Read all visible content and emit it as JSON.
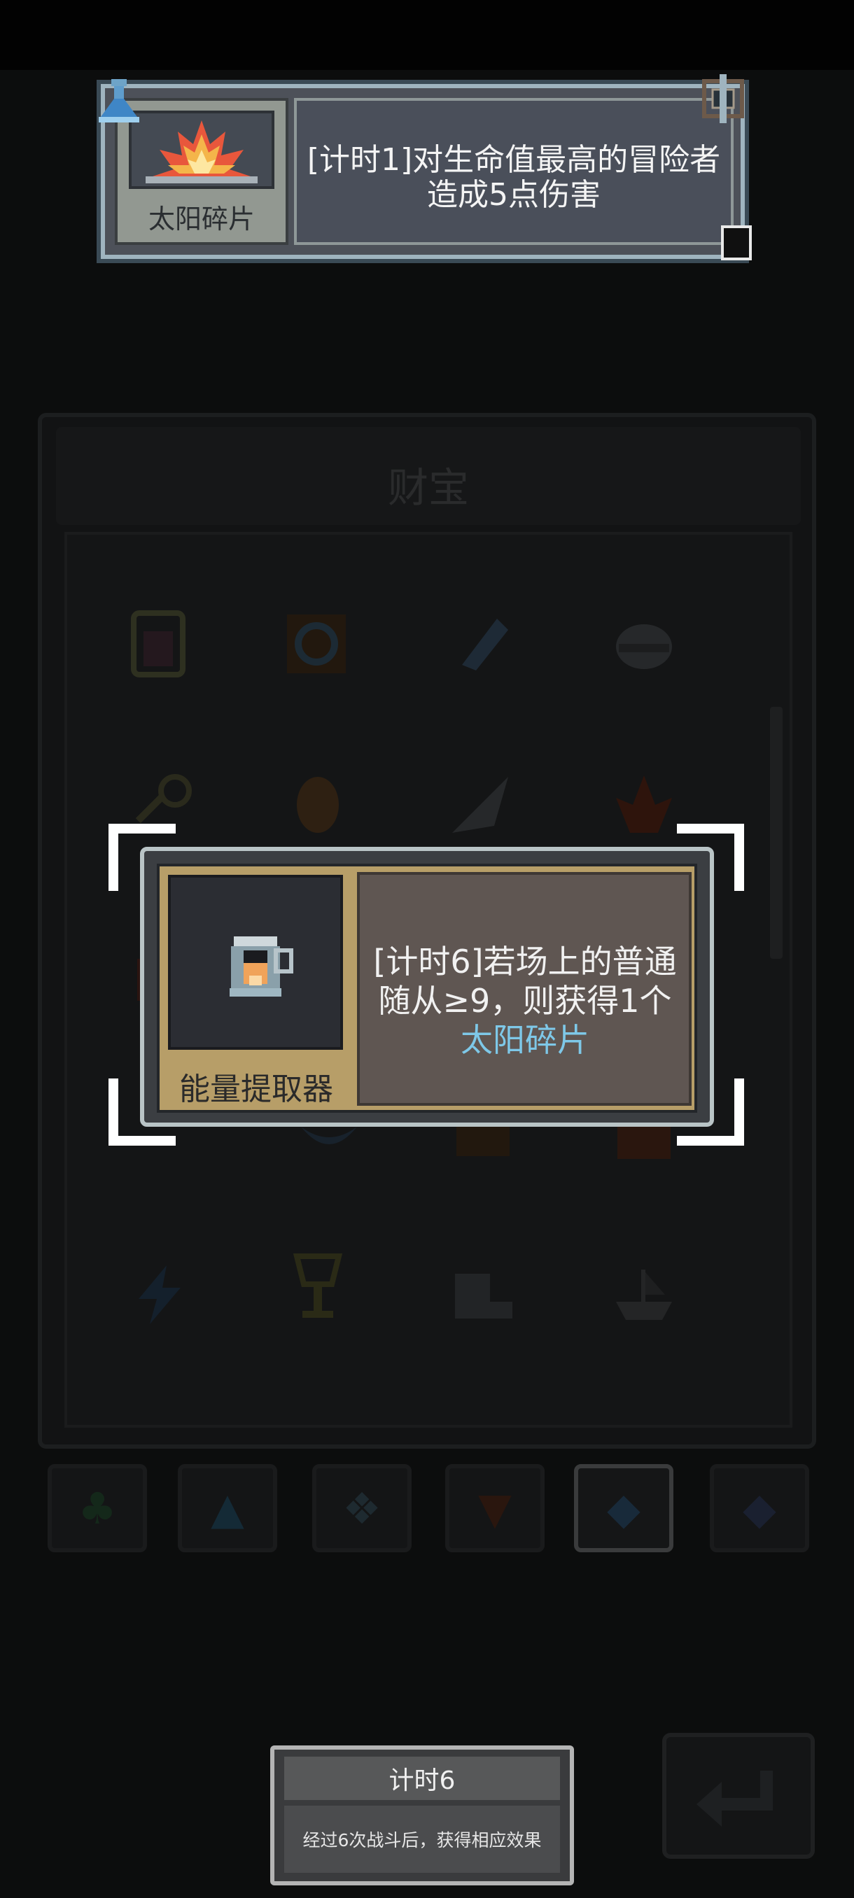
{
  "top_tooltip": {
    "item_name": "太阳碎片",
    "description": "[计时1]对生命值最高的冒险者造成5点伤害",
    "icon": "sun-shard-icon",
    "badge_icon": "flask-icon",
    "portal_icon": "portal-icon"
  },
  "treasure_panel": {
    "title": "财宝",
    "items": [
      "jar-icon",
      "ring-frame-icon",
      "feather-icon",
      "helmet-icon",
      "key-icon",
      "leaf-icon",
      "wing-icon",
      "flame-plant-icon",
      "red-gem-icon",
      "blank-slot",
      "blank-slot",
      "blank-slot",
      "blank-slot",
      "moon-icon",
      "chest-icon",
      "crate-icon",
      "lightning-icon",
      "chalice-icon",
      "boot-icon",
      "ship-icon"
    ]
  },
  "tabs": [
    {
      "icon": "clover-icon",
      "active": false
    },
    {
      "icon": "flask-icon",
      "active": false
    },
    {
      "icon": "gear-frame-icon",
      "active": false
    },
    {
      "icon": "fox-icon",
      "active": false
    },
    {
      "icon": "diamond-icon",
      "active": true
    },
    {
      "icon": "diamond-icon",
      "active": false
    }
  ],
  "dialog": {
    "item_name": "能量提取器",
    "description_line1": "[计时6]若场上的普通随从≥9，则获得1个",
    "description_highlight": "太阳碎片",
    "icon": "energy-extractor-icon",
    "highlight_color": "#7ec8e8"
  },
  "timer_card": {
    "title": "计时6",
    "body": "经过6次战斗后，获得相应效果"
  },
  "back_button": {
    "icon": "back-arrow-icon"
  }
}
